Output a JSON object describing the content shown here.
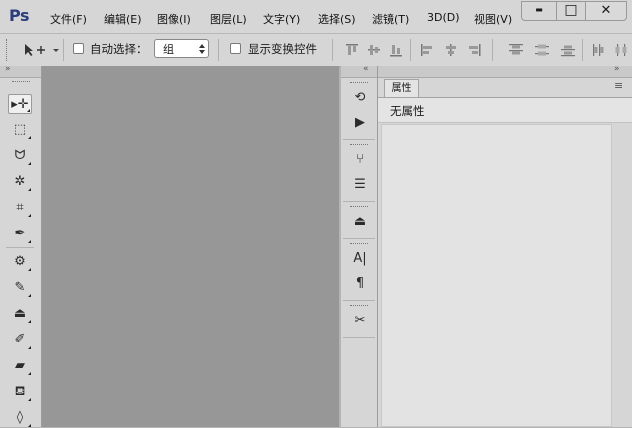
{
  "app": {
    "logo": "Ps"
  },
  "menubar": {
    "items": [
      "文件(F)",
      "编辑(E)",
      "图像(I)",
      "图层(L)",
      "文字(Y)",
      "选择(S)",
      "滤镜(T)",
      "3D(D)",
      "视图(V)"
    ]
  },
  "window_controls": {
    "minimize": "▬",
    "maximize": "□",
    "close": "✕"
  },
  "options_bar": {
    "auto_select_label": "自动选择：",
    "auto_select_checked": false,
    "auto_select_target": "组",
    "show_transform_label": "显示变换控件",
    "show_transform_checked": false
  },
  "panels": {
    "collapse_glyph": "»",
    "expand_glyph": "«",
    "properties_tab": "属性",
    "properties_menu_glyph": "≡",
    "properties_message": "无属性"
  },
  "tools": [
    {
      "name": "move-tool",
      "icon": "move-icon",
      "glyph": "▸✛",
      "selected": true
    },
    {
      "name": "marquee-tool",
      "icon": "rectangular-marquee-icon",
      "glyph": "⬚",
      "selected": false
    },
    {
      "name": "lasso-tool",
      "icon": "lasso-icon",
      "glyph": "ᗢ",
      "selected": false
    },
    {
      "name": "magic-wand-tool",
      "icon": "magic-wand-icon",
      "glyph": "✲",
      "selected": false
    },
    {
      "name": "crop-tool",
      "icon": "crop-icon",
      "glyph": "⌗",
      "selected": false
    },
    {
      "name": "eyedropper-tool",
      "icon": "eyedropper-icon",
      "glyph": "✒",
      "selected": false
    },
    {
      "name": "healing-tool",
      "icon": "healing-brush-icon",
      "glyph": "⚙",
      "selected": false
    },
    {
      "name": "brush-tool",
      "icon": "brush-icon",
      "glyph": "✎",
      "selected": false
    },
    {
      "name": "stamp-tool",
      "icon": "clone-stamp-icon",
      "glyph": "⏏",
      "selected": false
    },
    {
      "name": "history-brush-tool",
      "icon": "history-brush-icon",
      "glyph": "✐",
      "selected": false
    },
    {
      "name": "eraser-tool",
      "icon": "eraser-icon",
      "glyph": "▰",
      "selected": false
    },
    {
      "name": "paint-bucket-tool",
      "icon": "paint-bucket-icon",
      "glyph": "⛾",
      "selected": false
    },
    {
      "name": "blur-tool",
      "icon": "blur-drop-icon",
      "glyph": "◊",
      "selected": false
    }
  ],
  "side_icons": [
    {
      "name": "history-panel-button",
      "icon": "history-icon",
      "glyph": "⟲"
    },
    {
      "name": "actions-panel-button",
      "icon": "play-icon",
      "glyph": "▶"
    },
    {
      "name": "brush-presets-button",
      "icon": "brush-presets-icon",
      "glyph": "⑂"
    },
    {
      "name": "adjustments-button",
      "icon": "adjustment-sliders-icon",
      "glyph": "☰"
    },
    {
      "name": "clone-source-button",
      "icon": "clone-source-icon",
      "glyph": "⏏"
    },
    {
      "name": "character-panel-button",
      "icon": "character-icon",
      "glyph": "A|"
    },
    {
      "name": "paragraph-panel-button",
      "icon": "paragraph-icon",
      "glyph": "¶"
    },
    {
      "name": "tool-presets-button",
      "icon": "tool-presets-icon",
      "glyph": "✂"
    }
  ]
}
